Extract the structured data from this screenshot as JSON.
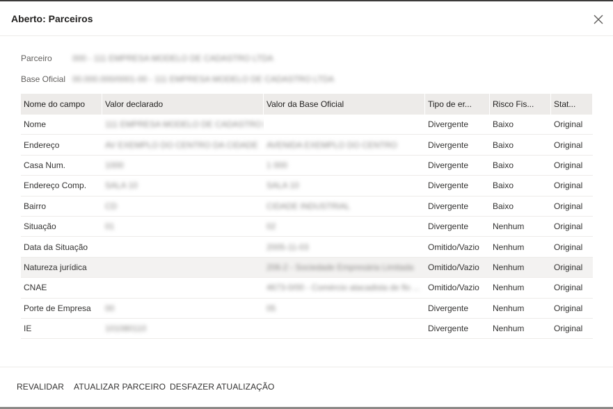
{
  "dialog": {
    "title": "Aberto: Parceiros",
    "close_icon": "close-icon"
  },
  "fields": {
    "partner_label": "Parceiro",
    "partner_value": "000 - 111 EMPRESA MODELO DE CADASTRO LTDA",
    "base_label": "Base Oficial",
    "base_value": "00.000.000/0001-00 - 111 EMPRESA MODELO DE CADASTRO LTDA"
  },
  "grid": {
    "headers": [
      "Nome do campo",
      "Valor declarado",
      "Valor da Base Oficial",
      "Tipo de er...",
      "Risco Fis...",
      "Stat..."
    ],
    "rows": [
      {
        "campo": "Nome",
        "declarado": "111 EMPRESA MODELO DE CADASTRO LTDA ...",
        "oficial": "",
        "tipo": "Divergente",
        "risco": "Baixo",
        "status": "Original"
      },
      {
        "campo": "Endereço",
        "declarado": "AV EXEMPLO DO CENTRO DA CIDADE",
        "oficial": "AVENIDA EXEMPLO DO CENTRO",
        "tipo": "Divergente",
        "risco": "Baixo",
        "status": "Original"
      },
      {
        "campo": "Casa Num.",
        "declarado": "1000",
        "oficial": "1 000",
        "tipo": "Divergente",
        "risco": "Baixo",
        "status": "Original"
      },
      {
        "campo": "Endereço Comp.",
        "declarado": "SALA 10",
        "oficial": "SALA 10",
        "tipo": "Divergente",
        "risco": "Baixo",
        "status": "Original"
      },
      {
        "campo": "Bairro",
        "declarado": "CD",
        "oficial": "CIDADE INDUSTRIAL",
        "tipo": "Divergente",
        "risco": "Baixo",
        "status": "Original"
      },
      {
        "campo": "Situação",
        "declarado": "01",
        "oficial": "02",
        "tipo": "Divergente",
        "risco": "Nenhum",
        "status": "Original"
      },
      {
        "campo": "Data da Situação",
        "declarado": "",
        "oficial": "2005-11-03",
        "tipo": "Omitido/Vazio",
        "risco": "Nenhum",
        "status": "Original"
      },
      {
        "campo": "Natureza jurídica",
        "declarado": "",
        "oficial": "206-2 - Sociedade Empresária Limitada",
        "tipo": "Omitido/Vazio",
        "risco": "Nenhum",
        "status": "Original"
      },
      {
        "campo": "CNAE",
        "declarado": "",
        "oficial": "4673-0/00 - Comércio atacadista de flo ...",
        "tipo": "Omitido/Vazio",
        "risco": "Nenhum",
        "status": "Original"
      },
      {
        "campo": "Porte de Empresa",
        "declarado": "00",
        "oficial": "05",
        "tipo": "Divergente",
        "risco": "Nenhum",
        "status": "Original"
      },
      {
        "campo": "IE",
        "declarado": "101080110",
        "oficial": "",
        "tipo": "Divergente",
        "risco": "Nenhum",
        "status": "Original"
      }
    ],
    "highlighted_row": 7
  },
  "footer": {
    "revalidar": "REVALIDAR",
    "atualizar": "ATUALIZAR PARCEIRO",
    "desfazer": "DESFAZER ATUALIZAÇÃO"
  },
  "colors": {
    "header_bg": "#edebe9",
    "row_highlight": "#f3f2f1",
    "text": "#323130"
  }
}
